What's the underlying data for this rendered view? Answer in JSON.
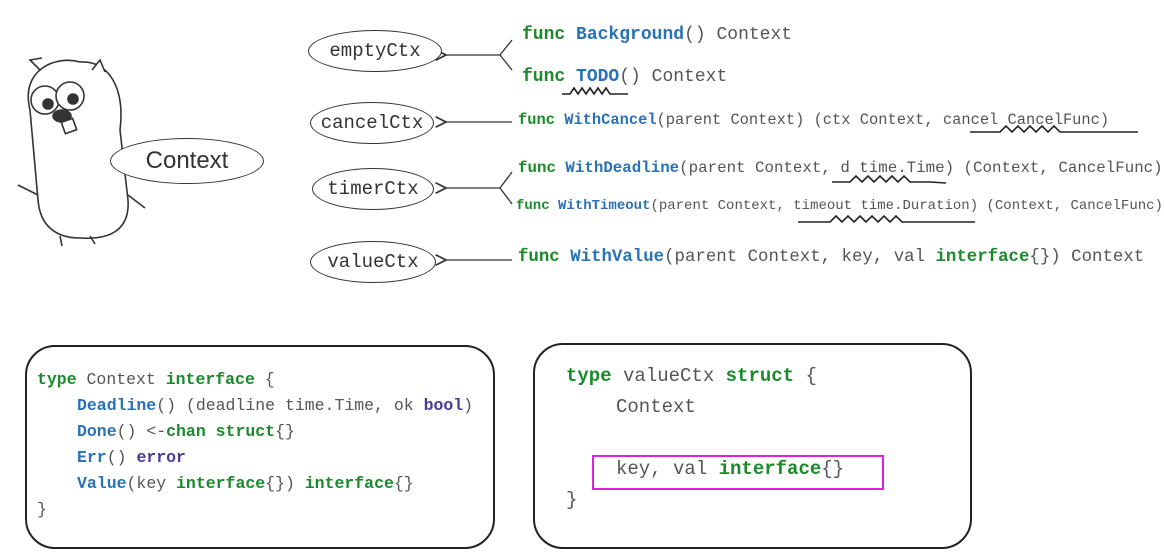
{
  "colors": {
    "keyword": "#1a8a2a",
    "function": "#2a72b8",
    "predeclared": "#4a3a9a",
    "text": "#555555",
    "highlight": "#e020e0"
  },
  "mascot": {
    "icon": "go-gopher",
    "label": "Context"
  },
  "nodes": [
    {
      "label": "emptyCtx"
    },
    {
      "label": "cancelCtx"
    },
    {
      "label": "timerCtx"
    },
    {
      "label": "valueCtx"
    }
  ],
  "funcs": {
    "background": {
      "kw": "func",
      "name": "Background",
      "rest": "() Context"
    },
    "todo": {
      "kw": "func",
      "name": "TODO",
      "rest": "() Context"
    },
    "withcancel": {
      "kw": "func",
      "name": "WithCancel",
      "rest": "(parent Context) (ctx Context, cancel CancelFunc)"
    },
    "withdeadline": {
      "kw": "func",
      "name": "WithDeadline",
      "rest": "(parent Context, d time.Time) (Context, CancelFunc)"
    },
    "withtimeout": {
      "kw": "func",
      "name": "WithTimeout",
      "rest": "(parent Context, timeout time.Duration) (Context, CancelFunc)"
    },
    "withvalue": {
      "kw": "func",
      "name": "WithValue",
      "rest1": "(parent Context, key, val ",
      "kw2": "interface",
      "rest2": "{}) Context"
    }
  },
  "interface_box": {
    "l1": {
      "kw": "type",
      "t": " Context ",
      "kw2": "interface",
      "t2": " {"
    },
    "l2": {
      "fn": "Deadline",
      "t": "() (deadline time.Time, ok ",
      "pt": "bool",
      "t2": ")"
    },
    "l3": {
      "fn": "Done",
      "t": "() <-",
      "kw": "chan",
      "t1": " ",
      "kw2": "struct",
      "t2": "{}"
    },
    "l4": {
      "fn": "Err",
      "t": "() ",
      "pt": "error"
    },
    "l5": {
      "fn": "Value",
      "t": "(key ",
      "kw": "interface",
      "t1": "{}) ",
      "kw2": "interface",
      "t2": "{}"
    },
    "l6": "}"
  },
  "struct_box": {
    "l1": {
      "kw": "type",
      "t": " valueCtx ",
      "kw2": "struct",
      "t2": " {"
    },
    "l2": "Context",
    "l3": {
      "t": "key, val ",
      "kw": "interface",
      "t2": "{}"
    },
    "l4": "}"
  }
}
